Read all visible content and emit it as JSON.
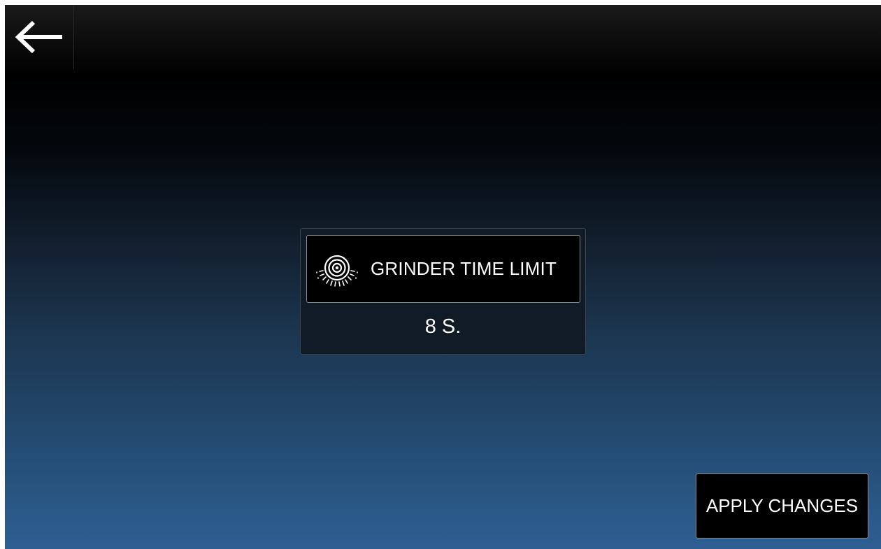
{
  "header": {
    "back_icon": "arrow-left-icon"
  },
  "setting": {
    "label": "GRINDER TIME LIMIT",
    "icon": "grinder-icon",
    "value": "8 S."
  },
  "actions": {
    "apply_label": "APPLY CHANGES"
  },
  "colors": {
    "gradient_top": "#000000",
    "gradient_bottom": "#2e5f93",
    "button_background": "#000000",
    "button_border": "#8a8a8a",
    "text": "#ffffff"
  }
}
